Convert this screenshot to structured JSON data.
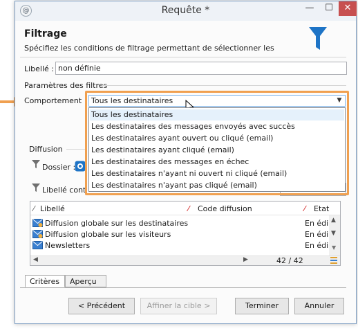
{
  "window": {
    "title": "Requête *",
    "min_glyph": "—",
    "max_glyph": "☐",
    "close_glyph": "✕",
    "app_glyph": "@"
  },
  "header": {
    "title": "Filtrage",
    "description": "Spécifiez les conditions de filtrage permettant de sélectionner les"
  },
  "libelle": {
    "label": "Libellé :",
    "value": "non définie"
  },
  "params": {
    "label": "Paramètres des filtres"
  },
  "comportement": {
    "label": "Comportement :",
    "selected": "Tous les destinataires",
    "options": [
      "Tous les destinataires",
      "Les destinataires des messages envoyés avec succès",
      "Les destinataires ayant ouvert ou cliqué (email)",
      "Les destinataires ayant cliqué (email)",
      "Les destinataires des messages en échec",
      "Les destinataires n'ayant ni ouvert ni cliqué (email)",
      "Les destinataires n'ayant pas cliqué (email)"
    ]
  },
  "diffusion": {
    "label": "Diffusion",
    "dossier_label": "Dossier :",
    "libelle_filter_label": "Libellé cont"
  },
  "list": {
    "columns": [
      "Libellé",
      "Code diffusion",
      "Etat"
    ],
    "rows": [
      {
        "label": "Diffusion globale sur les destinataires",
        "code": "",
        "state": "En édi"
      },
      {
        "label": "Diffusion globale sur les visiteurs",
        "code": "",
        "state": "En édi"
      },
      {
        "label": "Newsletters",
        "code": "",
        "state": "En édi"
      }
    ],
    "count": "42 / 42"
  },
  "tabs": [
    "Critères",
    "Aperçu"
  ],
  "buttons": {
    "previous": "< Précédent",
    "refine": "Affiner la cible >",
    "finish": "Terminer",
    "cancel": "Annuler"
  },
  "colors": {
    "accent": "#1e74c6",
    "highlight": "#f0a050",
    "close": "#c75050"
  }
}
